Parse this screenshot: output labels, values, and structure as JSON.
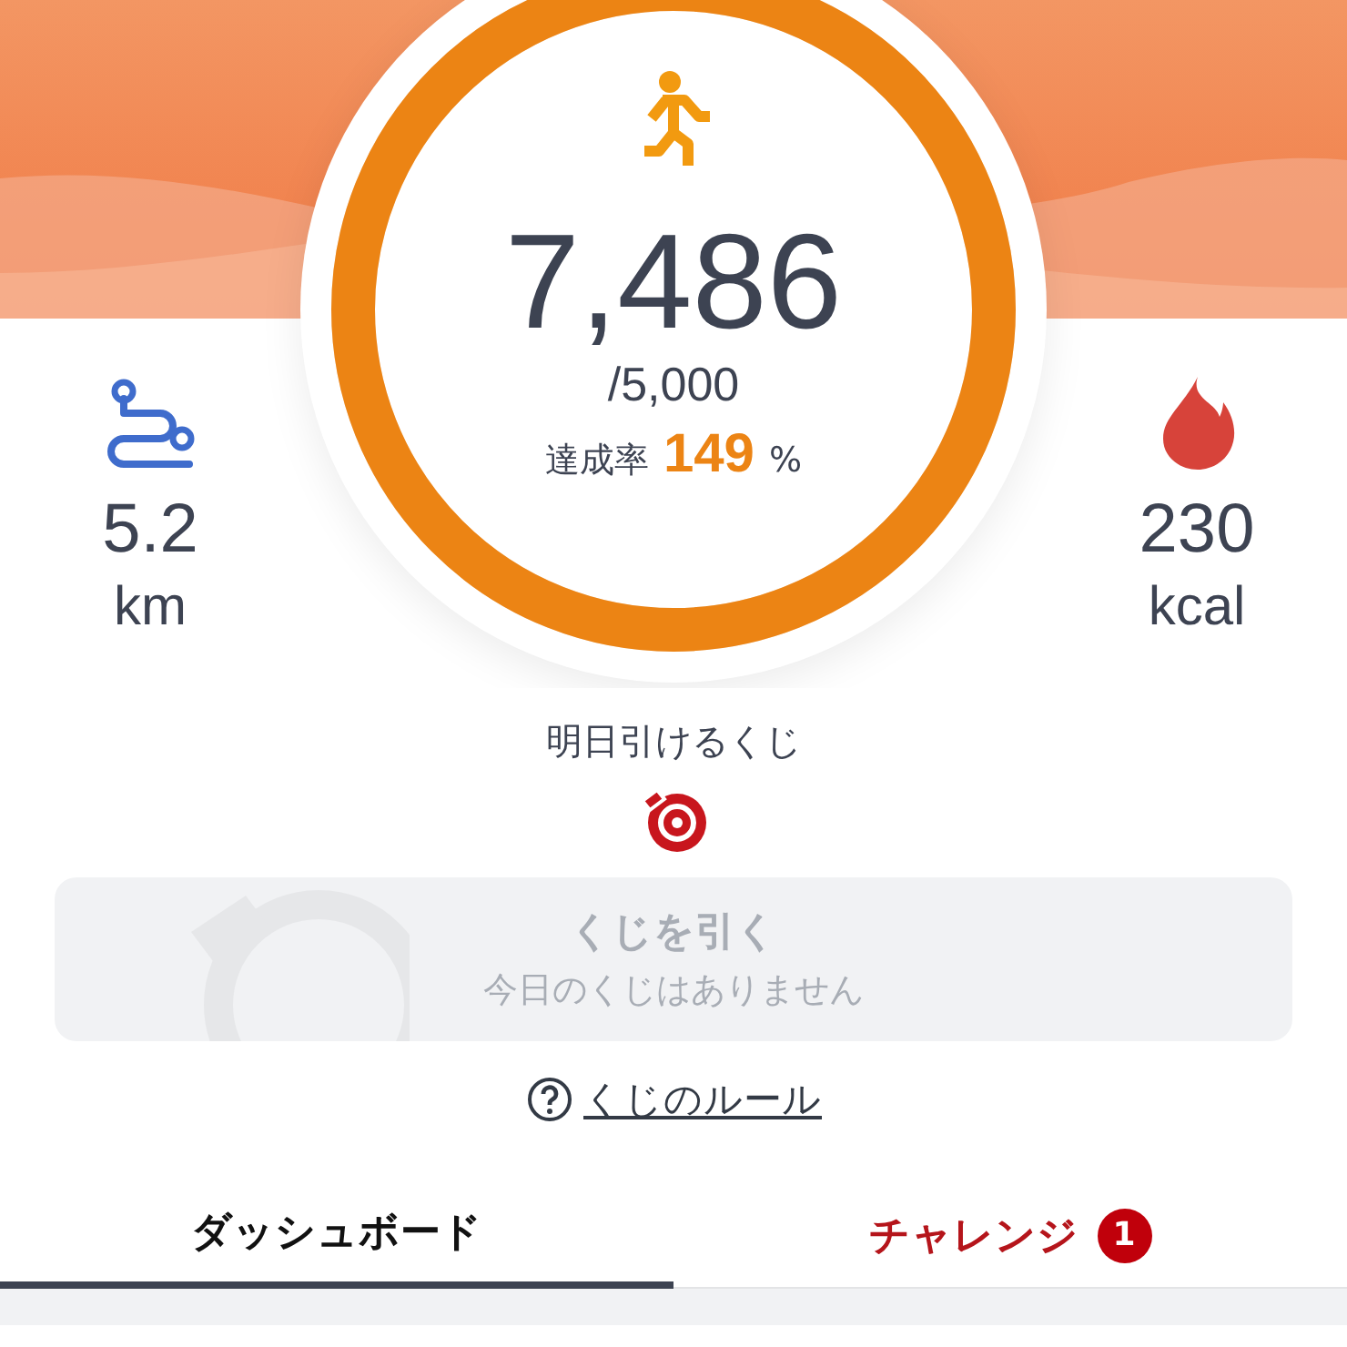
{
  "steps": {
    "value": "7,486",
    "goal": "/5,000",
    "rate_label": "達成率",
    "rate_value": "149",
    "rate_unit": "%",
    "level": 1
  },
  "stats": [
    {
      "kind": "distance",
      "value": "5.2",
      "unit": "km"
    },
    {
      "kind": "calories",
      "value": "230",
      "unit": "kcal"
    }
  ],
  "lottery": {
    "caption": "明日引けるくじ",
    "button_title": "くじを引く",
    "button_subtitle": "今日のくじはありません",
    "disabled": true,
    "rules_link": "くじのルール"
  },
  "tabs": [
    {
      "label": "ダッシュボード",
      "selected": true
    },
    {
      "label": "チャレンジ",
      "selected": false,
      "badge": "1"
    }
  ]
}
